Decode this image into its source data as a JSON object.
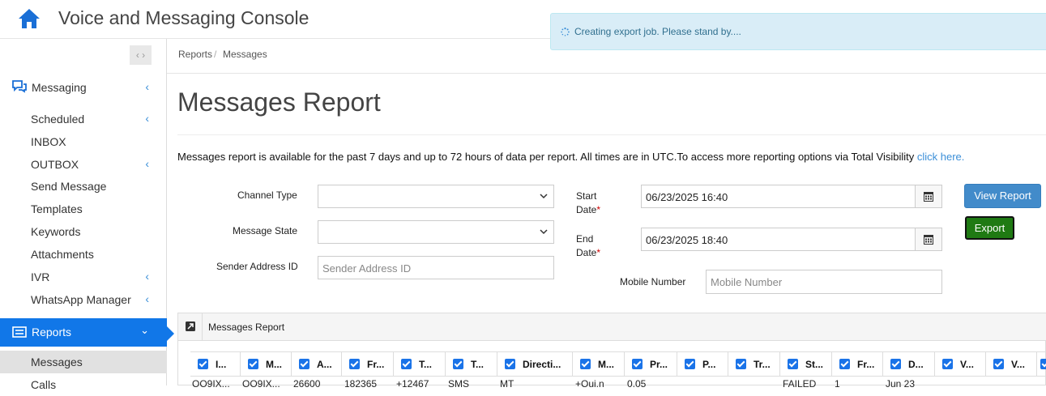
{
  "app": {
    "title": "Voice and Messaging Console"
  },
  "toast": {
    "message": "Creating export job. Please stand by...."
  },
  "sidebar": {
    "collapse_icon": "chevrons-left-right",
    "messaging": {
      "label": "Messaging",
      "icon": "chat-bubbles-icon"
    },
    "items": [
      {
        "label": "Scheduled",
        "has_chevron": true
      },
      {
        "label": "INBOX",
        "has_chevron": false
      },
      {
        "label": "OUTBOX",
        "has_chevron": true
      },
      {
        "label": "Send Message",
        "has_chevron": false
      },
      {
        "label": "Templates",
        "has_chevron": false
      },
      {
        "label": "Keywords",
        "has_chevron": false
      },
      {
        "label": "Attachments",
        "has_chevron": false
      },
      {
        "label": "IVR",
        "has_chevron": true
      },
      {
        "label": "WhatsApp Manager",
        "has_chevron": true
      }
    ],
    "reports": {
      "label": "Reports",
      "icon": "report-list-icon"
    },
    "sub_items": [
      {
        "label": "Messages",
        "active": true
      },
      {
        "label": "Calls",
        "active": false
      }
    ]
  },
  "breadcrumb": {
    "items": [
      "Reports",
      "Messages"
    ],
    "separator": "/"
  },
  "page": {
    "title": "Messages Report",
    "info_text": "Messages report is available for the past 7 days and up to 72 hours of data per report. All times are in UTC.To access more reporting options via Total Visibility ",
    "info_link": "click here."
  },
  "form": {
    "channel_type": {
      "label": "Channel Type",
      "value": ""
    },
    "message_state": {
      "label": "Message State",
      "value": ""
    },
    "sender_address": {
      "label": "Sender Address ID",
      "placeholder": "Sender Address ID",
      "value": ""
    },
    "start_date": {
      "label_line1": "Start",
      "label_line2": "Date",
      "required_mark": "*",
      "value": "06/23/2025 16:40"
    },
    "end_date": {
      "label_line1": "End",
      "label_line2": "Date",
      "required_mark": "*",
      "value": "06/23/2025 18:40"
    },
    "mobile_number": {
      "label": "Mobile Number",
      "placeholder": "Mobile Number",
      "value": ""
    },
    "view_report_label": "View Report",
    "export_label": "Export"
  },
  "report_panel": {
    "title": "Messages Report",
    "columns": [
      "I...",
      "M...",
      "A...",
      "Fr...",
      "T...",
      "T...",
      "Directi...",
      "M...",
      "Pr...",
      "P...",
      "Tr...",
      "St...",
      "Fr...",
      "D...",
      "V...",
      "V...",
      ""
    ],
    "partial_row": [
      "OO9IX...",
      "OO9IX...",
      "26600",
      "182365",
      "+12467",
      "SMS",
      "MT",
      "+Oui.n",
      "0.05",
      "",
      "",
      "FAILED",
      "1",
      "Jun 23",
      "",
      "",
      ""
    ]
  },
  "colors": {
    "primary": "#1177e8",
    "view_button": "#428bca",
    "export_button": "#1f7a13",
    "toast_bg": "#d9edf7",
    "link": "#3b8fd8"
  }
}
